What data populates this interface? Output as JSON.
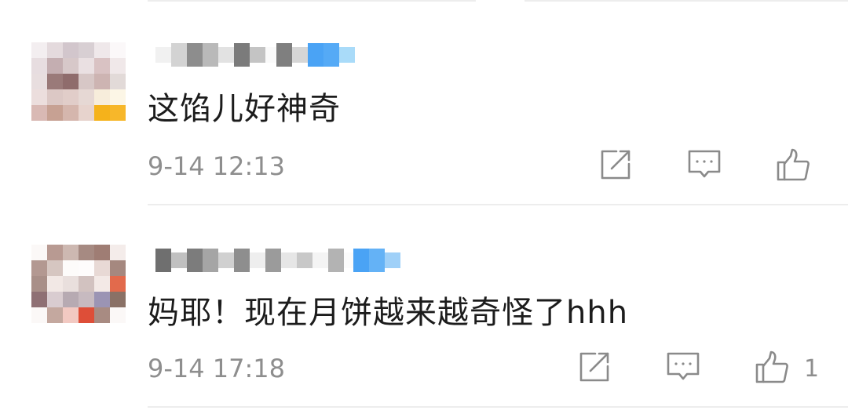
{
  "comments": [
    {
      "text": "这馅儿好神奇",
      "time": "9-14 12:13",
      "like_count": "",
      "avatar_icon": "pixelated-avatar",
      "username_state": "mosaic-redacted"
    },
    {
      "text": "妈耶！现在月饼越来越奇怪了hhh",
      "time": "9-14 17:18",
      "like_count": "1",
      "avatar_icon": "pixelated-avatar",
      "username_state": "mosaic-redacted"
    }
  ],
  "icons": {
    "share": "share-icon",
    "reply": "reply-icon",
    "like": "thumbs-up-icon"
  },
  "colors": {
    "text": "#1c1c1c",
    "meta": "#8e8e8e",
    "icon": "#8a8a8a",
    "divider": "#ededed",
    "badge_blue": "#4aa3f5"
  }
}
